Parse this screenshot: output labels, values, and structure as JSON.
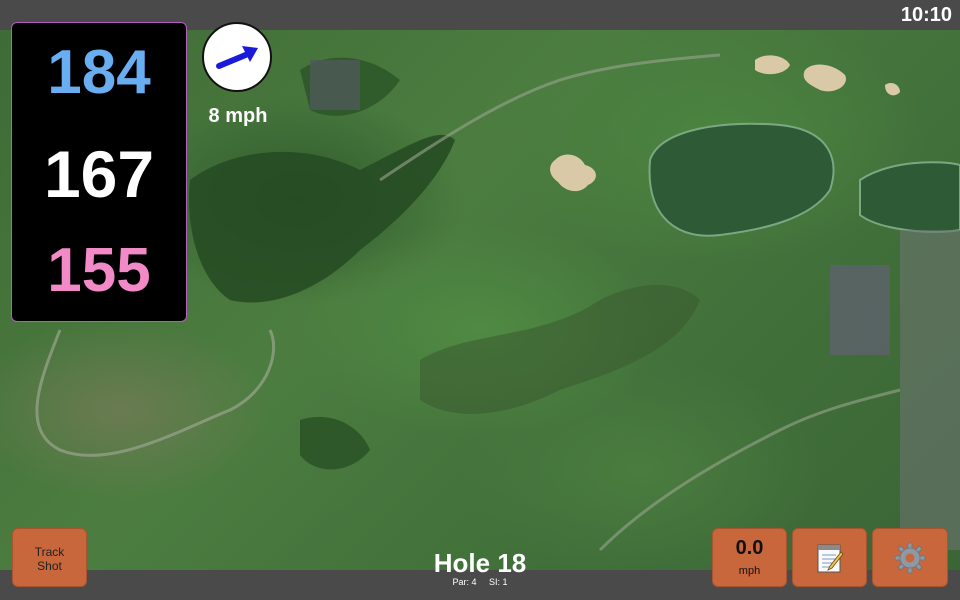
{
  "status": {
    "time": "10:10"
  },
  "distances": {
    "back": "184",
    "middle": "167",
    "front": "155"
  },
  "wind": {
    "speed": "8 mph",
    "icon": "wind-direction-arrow-icon",
    "arrow_color": "#1a1adb"
  },
  "hole": {
    "title": "Hole 18",
    "par": "Par: 4",
    "si": "SI: 1"
  },
  "buttons": {
    "track_shot_line1": "Track",
    "track_shot_line2": "Shot",
    "speed_value": "0.0",
    "speed_unit": "mph",
    "notes_icon": "notepad-icon",
    "settings_icon": "gear-icon"
  },
  "colors": {
    "back_distance": "#6aaef2",
    "middle_distance": "#ffffff",
    "front_distance": "#f28ac8",
    "button_accent": "#c8663c",
    "panel_border": "#b45fc0"
  }
}
